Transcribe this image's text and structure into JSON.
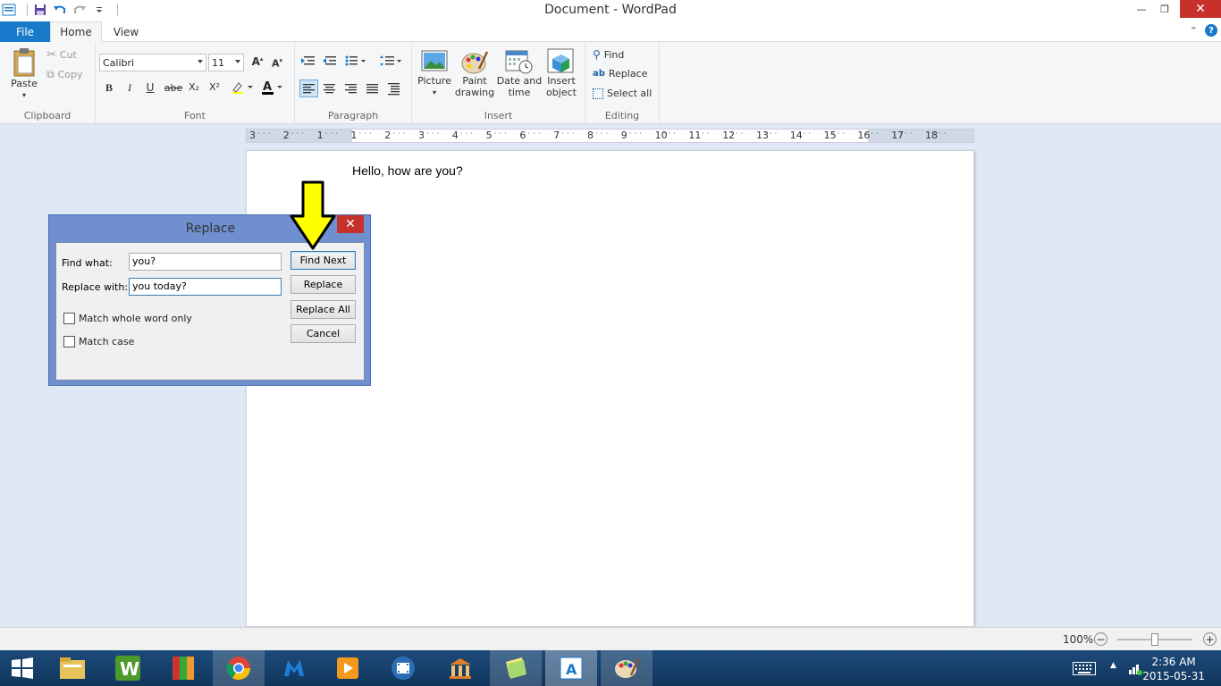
{
  "window": {
    "title": "Document - WordPad",
    "close_label": "✕",
    "min_label": "—",
    "max_label": "❐"
  },
  "ribbon_tabs": {
    "file": "File",
    "home": "Home",
    "view": "View"
  },
  "clipboard": {
    "paste": "Paste",
    "cut": "Cut",
    "copy": "Copy",
    "label": "Clipboard"
  },
  "font": {
    "family": "Calibri",
    "size": "11",
    "label": "Font",
    "bold": "B",
    "italic": "I",
    "underline": "U",
    "strike": "abe",
    "sub": "X₂",
    "sup": "X²"
  },
  "paragraph": {
    "label": "Paragraph"
  },
  "insert": {
    "picture": "Picture",
    "paint": "Paint drawing",
    "paint1": "Paint",
    "paint2": "drawing",
    "date1": "Date and",
    "date2": "time",
    "obj1": "Insert",
    "obj2": "object",
    "label": "Insert"
  },
  "editing": {
    "find": "Find",
    "replace": "Replace",
    "select_all": "Select all",
    "label": "Editing"
  },
  "ruler": {
    "ticks": [
      "3",
      "2",
      "1",
      "1",
      "2",
      "3",
      "4",
      "5",
      "6",
      "7",
      "8",
      "9",
      "10",
      "11",
      "12",
      "13",
      "14",
      "15",
      "16",
      "17",
      "18"
    ]
  },
  "document": {
    "text": "Hello, how are you?"
  },
  "dialog": {
    "title": "Replace",
    "close_label": "✕",
    "find_label": "Find what:",
    "find_value": "you?",
    "replace_label": "Replace with:",
    "replace_value": "you today?",
    "match_whole": "Match whole word only",
    "match_case": "Match case",
    "find_next": "Find Next",
    "replace_btn": "Replace",
    "replace_all": "Replace All",
    "cancel": "Cancel"
  },
  "status": {
    "zoom": "100%",
    "zoom_level": 0.5
  },
  "taskbar": {
    "time": "2:36 AM",
    "date": "2015-05-31"
  },
  "colors": {
    "accent": "#1979ca",
    "close": "#c7312b",
    "dialog_frame": "#6f8fcf",
    "arrow": "#ffff00"
  }
}
